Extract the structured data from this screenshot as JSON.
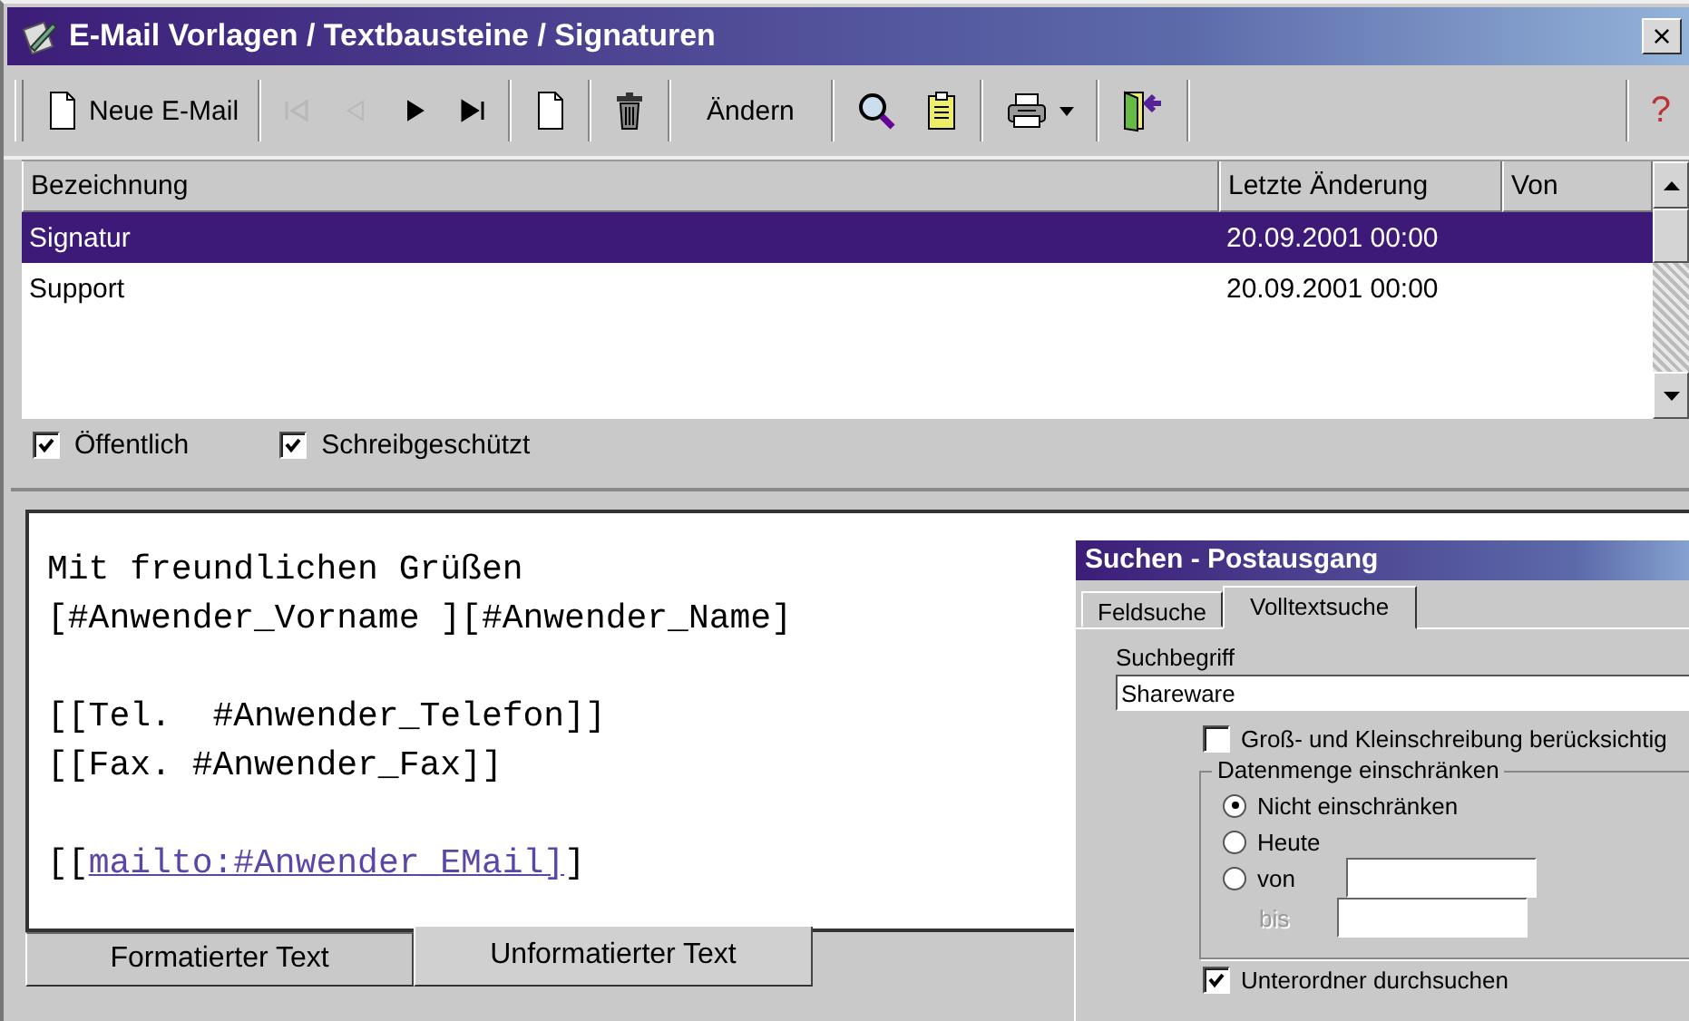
{
  "window": {
    "title": "E-Mail Vorlagen / Textbausteine / Signaturen",
    "close": "×"
  },
  "toolbar": {
    "new_email": {
      "label": "Neue E-Mail"
    },
    "navigation": [
      {
        "disabled": true
      },
      {
        "disabled": true
      },
      {
        "disabled": false
      },
      {
        "disabled": false
      }
    ],
    "edit_button": {
      "label": "Ändern"
    },
    "help": "?"
  },
  "table": {
    "columns": [
      "Bezeichnung",
      "Letzte Änderung",
      "Von"
    ],
    "rows": [
      {
        "cells": [
          "Signatur",
          "20.09.2001 00:00"
        ],
        "selected": true
      },
      {
        "cells": [
          "Support",
          "20.09.2001 00:00"
        ],
        "selected": false
      }
    ]
  },
  "options": [
    {
      "label": "Öffentlich",
      "checked": true
    },
    {
      "label": "Schreibgeschützt",
      "checked": true
    }
  ],
  "editor": {
    "paragraphs": [
      [
        {
          "text": "Mit freundlichen Grüßen"
        },
        {
          "text": "[#Anwender_Vorname ][#Anwender_Name]"
        }
      ],
      [
        {
          "text": "[[Tel.  #Anwender_Telefon]]"
        },
        {
          "text": "[[Fax. #Anwender_Fax]]"
        }
      ],
      [
        {
          "kind": "link",
          "before": "[[",
          "link": "mailto:#Anwender_EMail]",
          "after": "]"
        }
      ]
    ],
    "tabs": [
      {
        "label": "Formatierter Text",
        "selected": false
      },
      {
        "label": "Unformatierter Text",
        "selected": true
      }
    ]
  },
  "search_dialog": {
    "title": "Suchen - Postausgang",
    "tabs": [
      {
        "label": "Feldsuche",
        "selected": false
      },
      {
        "label": "Volltextsuche",
        "selected": true
      }
    ],
    "search_label": "Suchbegriff",
    "search_value": "Shareware",
    "case_option": {
      "label": "Groß- und Kleinschreibung berücksichtig",
      "checked": false
    },
    "group": {
      "title": "Datenmenge einschränken",
      "radios": [
        {
          "label": "Nicht einschränken",
          "selected": true
        },
        {
          "label": "Heute",
          "selected": false
        },
        {
          "label": "von",
          "selected": false
        }
      ],
      "to_label": "bis"
    },
    "subfolder_option": {
      "label": "Unterordner durchsuchen",
      "checked": true
    }
  }
}
